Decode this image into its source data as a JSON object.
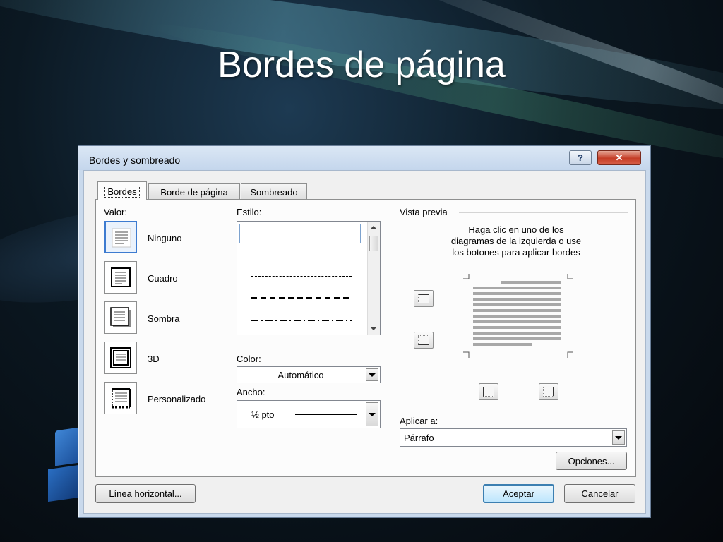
{
  "slide": {
    "title": "Bordes de página"
  },
  "dialog": {
    "title": "Bordes y sombreado",
    "help_glyph": "?",
    "close_glyph": "✕",
    "tabs": [
      "Bordes",
      "Borde de página",
      "Sombreado"
    ],
    "setting": {
      "label": "Valor:",
      "options": [
        "Ninguno",
        "Cuadro",
        "Sombra",
        "3D",
        "Personalizado"
      ],
      "selected": "Ninguno"
    },
    "style": {
      "label": "Estilo:",
      "line_styles": [
        "solid",
        "dotted",
        "dashed-fine",
        "dashed",
        "dash-dot"
      ],
      "selected": "solid"
    },
    "color": {
      "label": "Color:",
      "value": "Automático"
    },
    "width": {
      "label": "Ancho:",
      "value": "½ pto"
    },
    "preview": {
      "label": "Vista previa",
      "instructions": [
        "Haga clic en uno de los",
        "diagramas de la izquierda o use",
        "los botones para aplicar bordes"
      ]
    },
    "apply_to": {
      "label": "Aplicar a:",
      "value": "Párrafo"
    },
    "buttons": {
      "options": "Opciones...",
      "horizontal_line": "Línea horizontal...",
      "ok": "Aceptar",
      "cancel": "Cancelar"
    },
    "colors": {
      "selection_border": "#3d7bd0",
      "close_red": "#c43c25",
      "default_button": "#3c7fb1"
    }
  }
}
